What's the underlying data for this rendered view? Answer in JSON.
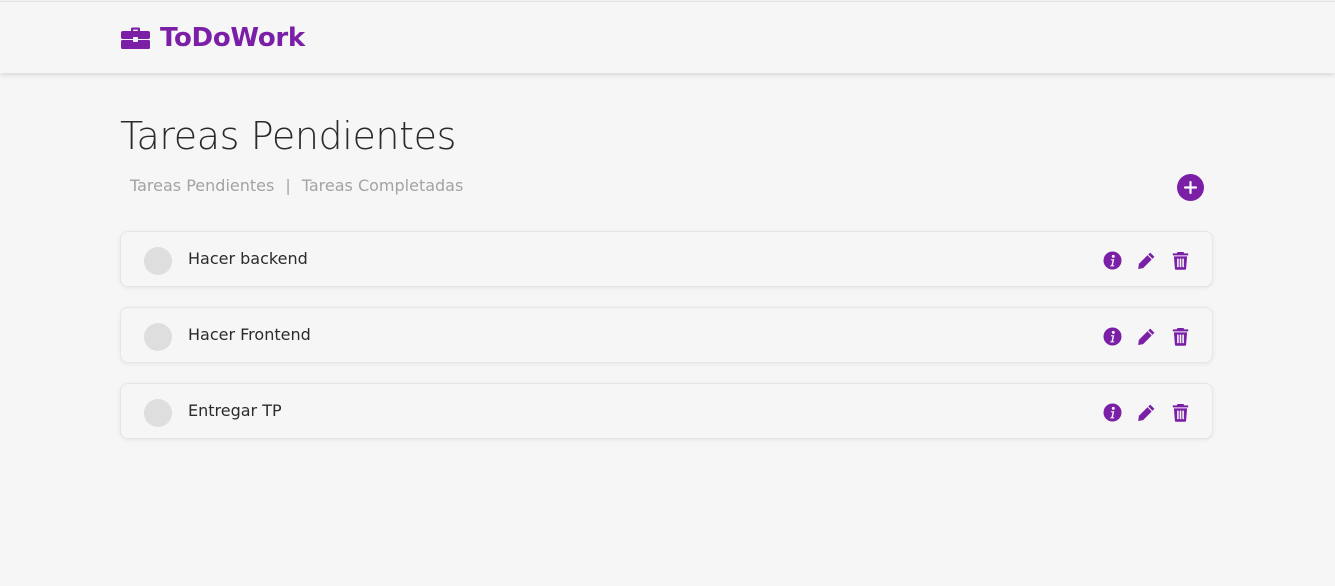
{
  "app": {
    "brand_name": "ToDoWork",
    "brand_icon": "briefcase-icon",
    "accent_color": "#7a1fa6"
  },
  "main": {
    "title": "Tareas Pendientes",
    "filters": {
      "pending_label": "Tareas Pendientes",
      "separator": "|",
      "completed_label": "Tareas Completadas"
    },
    "add_icon": "plus-circle-icon"
  },
  "tasks": [
    {
      "title": "Hacer backend",
      "completed": false
    },
    {
      "title": "Hacer Frontend",
      "completed": false
    },
    {
      "title": "Entregar TP",
      "completed": false
    }
  ],
  "task_action_icons": [
    "info-icon",
    "pencil-icon",
    "trash-icon"
  ]
}
